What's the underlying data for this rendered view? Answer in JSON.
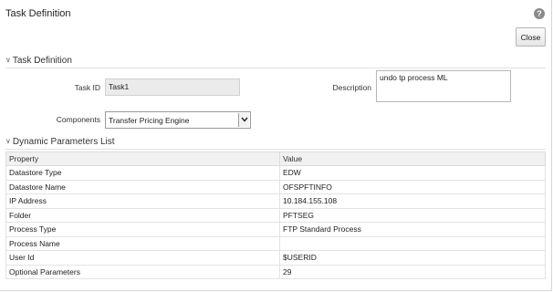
{
  "window": {
    "title": "Task Definition",
    "help_icon": "?",
    "close_label": "Close"
  },
  "task_definition": {
    "header": "Task Definition",
    "task_id_label": "Task ID",
    "task_id_value": "Task1",
    "description_label": "Description",
    "description_value": "undo tp process ML",
    "components_label": "Components",
    "components_value": "Transfer Pricing Engine"
  },
  "dynamic_parameters": {
    "header": "Dynamic Parameters List",
    "columns": [
      "Property",
      "Value"
    ],
    "rows": [
      {
        "property": "Datastore Type",
        "value": "EDW"
      },
      {
        "property": "Datastore Name",
        "value": "OFSPFTINFO"
      },
      {
        "property": "IP Address",
        "value": "10.184.155.108"
      },
      {
        "property": "Folder",
        "value": "PFTSEG"
      },
      {
        "property": "Process Type",
        "value": "FTP Standard Process"
      },
      {
        "property": "Process Name",
        "value": ""
      },
      {
        "property": "User Id",
        "value": "$USERID"
      },
      {
        "property": "Optional Parameters",
        "value": "29"
      }
    ]
  }
}
